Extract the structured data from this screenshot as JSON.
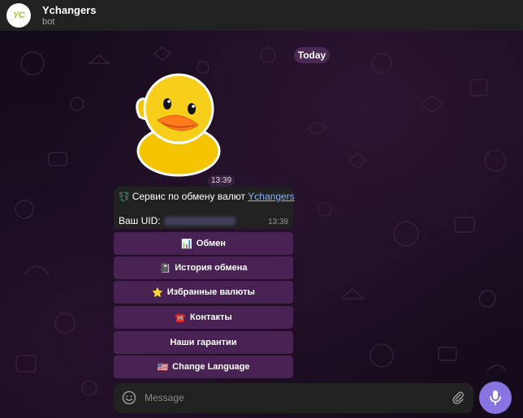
{
  "header": {
    "avatar_text": "YC",
    "title": "Ychangers",
    "subtitle": "bot"
  },
  "chat": {
    "date_label": "Today",
    "sticker": {
      "icon": "duck-sticker",
      "time": "13:39"
    },
    "message": {
      "coin_icon": "💱",
      "text": "Сервис по обмену валют",
      "link_text": "Ychangers",
      "uid_label": "Ваш UID:",
      "time": "13:39"
    }
  },
  "keyboard": {
    "buttons": [
      {
        "icon": "📊",
        "label": "Обмен"
      },
      {
        "icon": "📓",
        "label": "История обмена"
      },
      {
        "icon": "⭐",
        "label": "Избранные валюты"
      },
      {
        "icon": "☎️",
        "label": "Контакты"
      },
      {
        "icon": "",
        "label": "Наши гарантии"
      },
      {
        "icon": "🇺🇸",
        "label": "Change Language"
      }
    ]
  },
  "composer": {
    "placeholder": "Message",
    "value": ""
  },
  "colors": {
    "accent": "#8774e1",
    "link": "#8ab4f8",
    "keyboard_button": "#50265c",
    "header": "#212121"
  }
}
